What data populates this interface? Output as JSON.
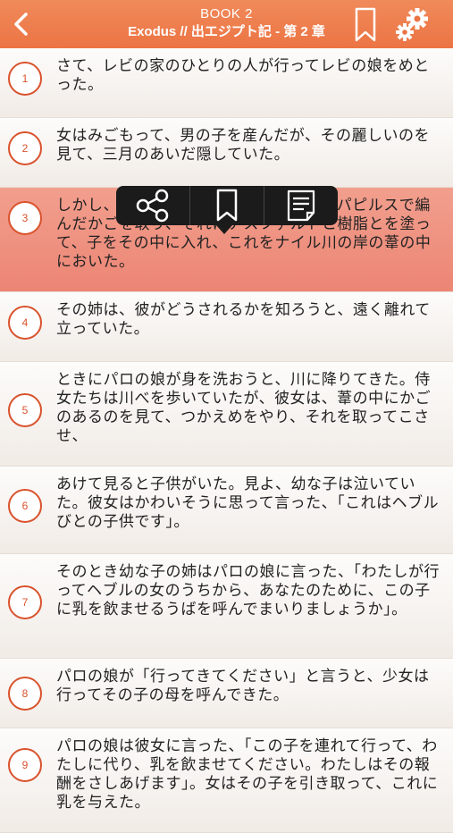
{
  "header": {
    "book": "BOOK 2",
    "chapter": "Exodus // 出エジプト記 - 第 2 章",
    "colors": {
      "bar": "#ec7444",
      "accent": "#d9522c",
      "selected_row": "#ec8574"
    },
    "icons": {
      "back": "chevron-left-icon",
      "bookmark": "bookmark-icon",
      "settings": "gears-icon"
    }
  },
  "popup": {
    "icons": [
      "share-icon",
      "bookmark-icon",
      "note-icon"
    ]
  },
  "verses": [
    {
      "num": "1",
      "text": "さて、レビの家のひとりの人が行ってレビの娘をめとった。"
    },
    {
      "num": "2",
      "text": "女はみごもって、男の子を産んだが、その麗しいのを見て、三月のあいだ隠していた。"
    },
    {
      "num": "3",
      "text": "しかし、もう隠しきれなくなったので、パピルスで編んだかごを取り、それにアスファルトと樹脂とを塗って、子をその中に入れ、これをナイル川の岸の葦の中においた。"
    },
    {
      "num": "4",
      "text": "その姉は、彼がどうされるかを知ろうと、遠く離れて立っていた。"
    },
    {
      "num": "5",
      "text": "ときにパロの娘が身を洗おうと、川に降りてきた。侍女たちは川べを歩いていたが、彼女は、葦の中にかごのあるのを見て、つかえめをやり、それを取ってこさせ、"
    },
    {
      "num": "6",
      "text": "あけて見ると子供がいた。見よ、幼な子は泣いていた。彼女はかわいそうに思って言った、「これはヘブルびとの子供です」。"
    },
    {
      "num": "7",
      "text": "そのとき幼な子の姉はパロの娘に言った、「わたしが行ってヘブルの女のうちから、あなたのために、この子に乳を飲ませるうばを呼んでまいりましょうか」。"
    },
    {
      "num": "8",
      "text": "パロの娘が「行ってきてください」と言うと、少女は行ってその子の母を呼んできた。"
    },
    {
      "num": "9",
      "text": "パロの娘は彼女に言った、「この子を連れて行って、わたしに代り、乳を飲ませてください。わたしはその報酬をさしあげます」。女はその子を引き取って、これに乳を与えた。"
    }
  ]
}
